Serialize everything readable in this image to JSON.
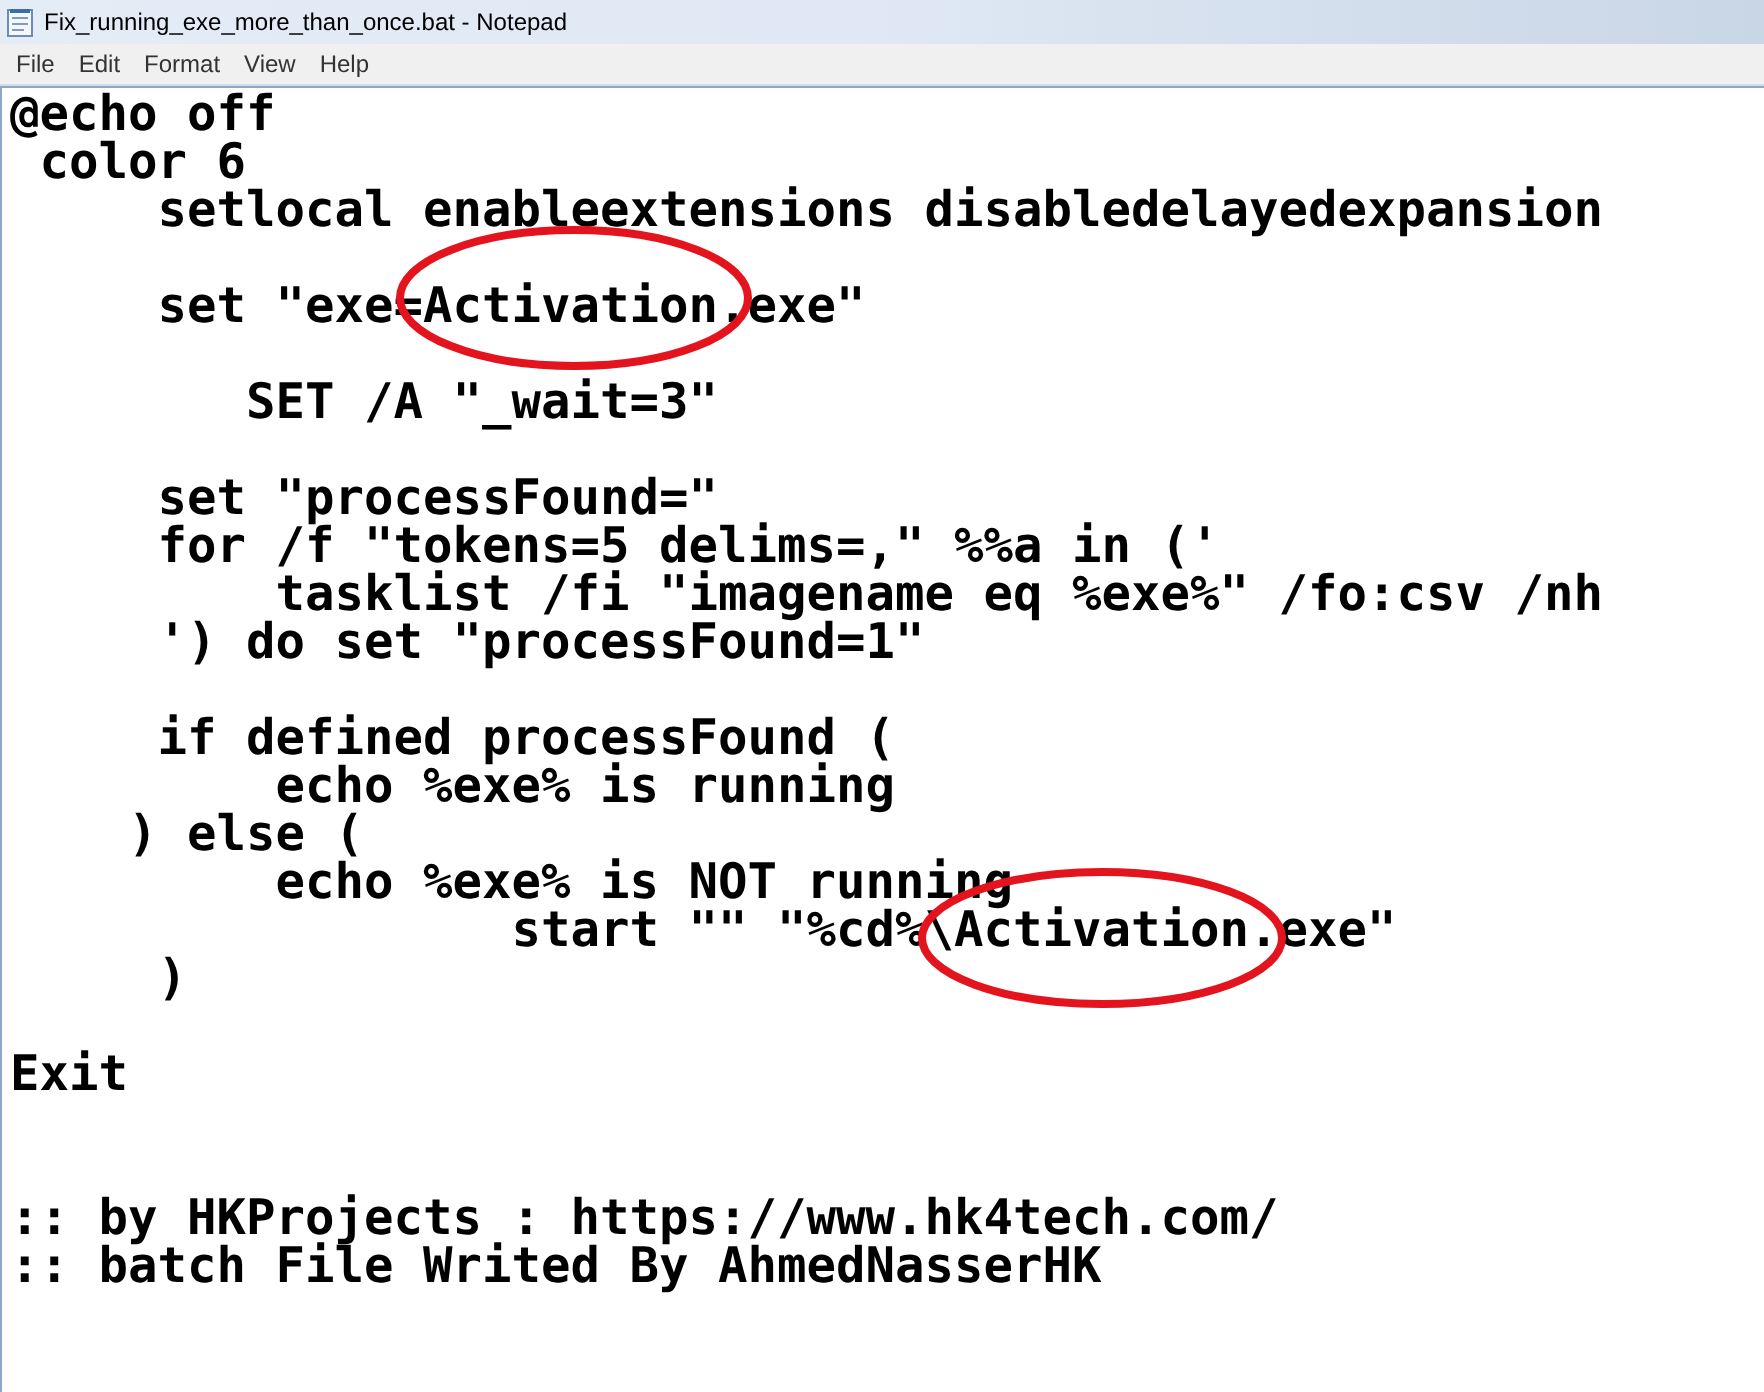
{
  "window": {
    "title": "Fix_running_exe_more_than_once.bat - Notepad"
  },
  "menu": [
    "File",
    "Edit",
    "Format",
    "View",
    "Help"
  ],
  "editor": {
    "lines": [
      {
        "kind": "text",
        "text": "@echo off"
      },
      {
        "kind": "text",
        "text": " color 6"
      },
      {
        "kind": "text",
        "text": "     setlocal enableextensions disabledelayedexpansion"
      },
      {
        "kind": "blank"
      },
      {
        "kind": "text",
        "text": "     set \"exe=Activation.exe\""
      },
      {
        "kind": "blank"
      },
      {
        "kind": "text",
        "text": "        SET /A \"_wait=3\""
      },
      {
        "kind": "blank"
      },
      {
        "kind": "text",
        "text": "     set \"processFound=\""
      },
      {
        "kind": "text",
        "text": "     for /f \"tokens=5 delims=,\" %%a in ('"
      },
      {
        "kind": "text",
        "text": "         tasklist /fi \"imagename eq %exe%\" /fo:csv /nh"
      },
      {
        "kind": "text",
        "text": "     ') do set \"processFound=1\""
      },
      {
        "kind": "blank"
      },
      {
        "kind": "text",
        "text": "     if defined processFound ("
      },
      {
        "kind": "text",
        "text": "         echo %exe% is running"
      },
      {
        "kind": "text",
        "text": "    ) else ("
      },
      {
        "kind": "text",
        "text": "         echo %exe% is NOT running"
      },
      {
        "kind": "text",
        "text": "                 start \"\" \"%cd%\\Activation.exe\""
      },
      {
        "kind": "text",
        "text": "     )"
      },
      {
        "kind": "blank"
      },
      {
        "kind": "text",
        "text": "Exit"
      },
      {
        "kind": "blank"
      },
      {
        "kind": "blank"
      },
      {
        "kind": "text",
        "text": ":: by HKProjects : https://www.hk4tech.com/"
      },
      {
        "kind": "text",
        "text": ":: batch File Writed By AhmedNasserHK"
      }
    ]
  },
  "annotations": [
    {
      "kind": "ellipse"
    },
    {
      "kind": "ellipse"
    }
  ]
}
